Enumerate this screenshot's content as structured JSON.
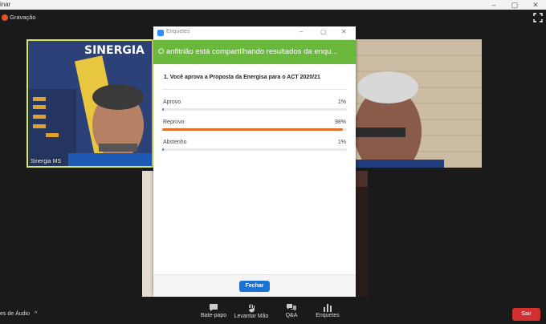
{
  "window": {
    "app_title_fragment": "inar"
  },
  "recording": {
    "label": "Gravação"
  },
  "participants": [
    {
      "name": "Sinergia MS"
    }
  ],
  "poll": {
    "window_title": "Enquetes",
    "banner": "O anfitrião está compartilhando resultados da enqu...",
    "question": "1. Você aprova a Proposta da Energisa para o ACT 2020/21",
    "answers": [
      {
        "label": "Aprovo",
        "percent_text": "1%",
        "value": 1,
        "color": "#2d8cff"
      },
      {
        "label": "Reprovo",
        "percent_text": "98%",
        "value": 98,
        "color": "#e0702a"
      },
      {
        "label": "Abstenho",
        "percent_text": "1%",
        "value": 1,
        "color": "#2d8cff"
      }
    ],
    "close_label": "Fechar"
  },
  "toolbar": {
    "audio_label": "es de Áudio",
    "chat_label": "Bate-papo",
    "raise_hand_label": "Levantar Mão",
    "qa_label": "Q&A",
    "polls_label": "Enquetes",
    "leave_label": "Sair"
  },
  "colors": {
    "accent": "#2d8cff",
    "banner": "#6ab83c",
    "leave": "#d32f2f"
  }
}
